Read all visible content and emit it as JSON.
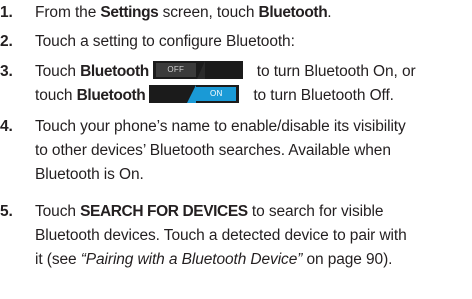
{
  "steps": [
    {
      "num": "1.",
      "pre": "From the ",
      "b1": "Settings",
      "mid": " screen, touch ",
      "b2": "Bluetooth",
      "post": "."
    },
    {
      "num": "2.",
      "text": "Touch a setting to configure Bluetooth:"
    },
    {
      "num": "3.",
      "pre": "Touch ",
      "b1": "Bluetooth",
      "post": "to turn Bluetooth On, or"
    },
    {
      "cont": "touch ",
      "b1": "Bluetooth",
      "post": "to turn Bluetooth Off."
    },
    {
      "num": "4.",
      "text": "Touch your phone’s name to enable/disable its visibility"
    },
    {
      "cont": "to other devices’ Bluetooth searches. Available when"
    },
    {
      "cont": "Bluetooth is On."
    },
    {
      "num": "5.",
      "pre": "Touch ",
      "b1": "SEARCH FOR DEVICES",
      "post": " to search for visible"
    },
    {
      "cont": "Bluetooth devices. Touch a detected device to pair with"
    },
    {
      "pre": "it (see ",
      "i1": "“Pairing with a Bluetooth Device”",
      "post": " on page 90)."
    }
  ],
  "toggles": {
    "off_label": "OFF",
    "on_label": "ON",
    "accent": "#1a9ad6"
  }
}
